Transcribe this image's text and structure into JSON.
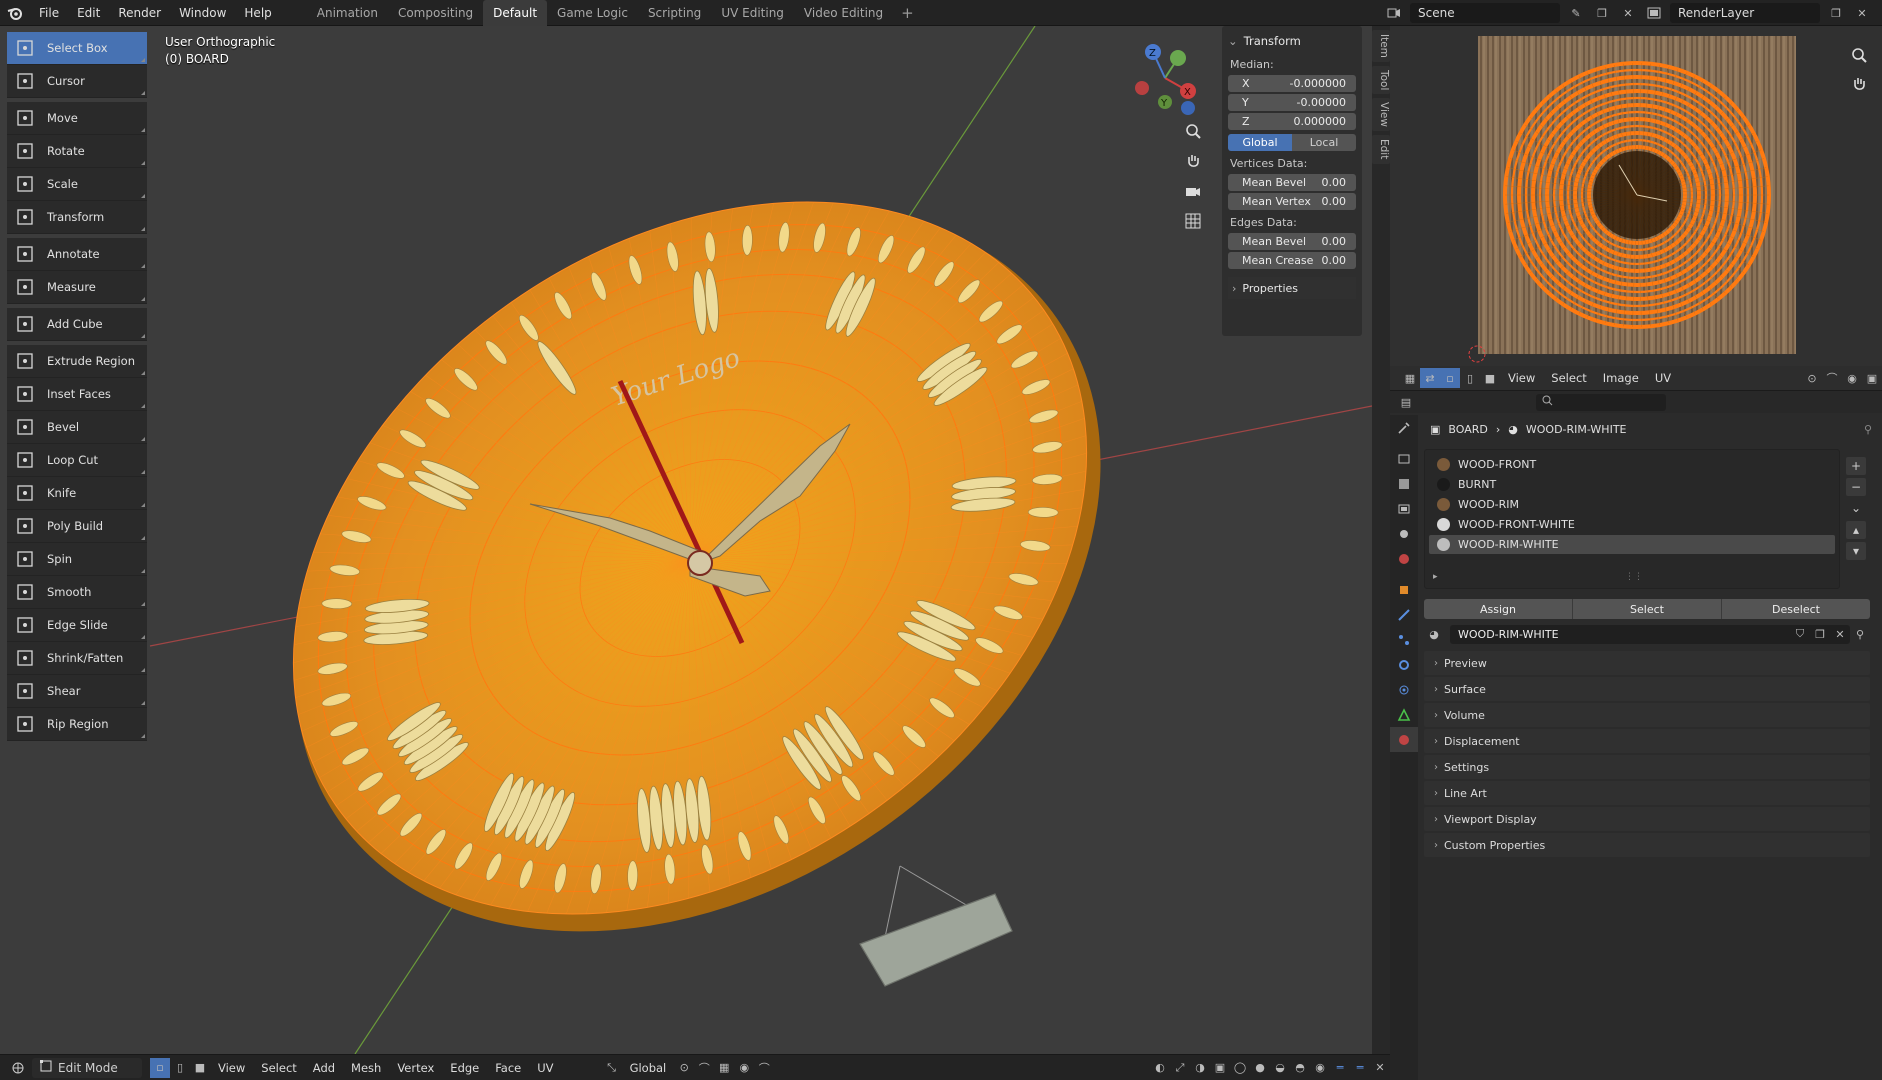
{
  "topbar": {
    "menus": [
      "File",
      "Edit",
      "Render",
      "Window",
      "Help"
    ],
    "workspaces": [
      "Animation",
      "Compositing",
      "Default",
      "Game Logic",
      "Scripting",
      "UV Editing",
      "Video Editing"
    ],
    "active_workspace": "Default",
    "add_symbol": "+",
    "scene": "Scene",
    "view_layer": "RenderLayer"
  },
  "viewport": {
    "view_name": "User Orthographic",
    "object_name": "(0) BOARD",
    "logo_text": "Your Logo"
  },
  "toolbar": {
    "groups": [
      [
        {
          "label": "Select Box",
          "active": true
        },
        {
          "label": "Cursor"
        }
      ],
      [
        {
          "label": "Move"
        },
        {
          "label": "Rotate"
        },
        {
          "label": "Scale"
        },
        {
          "label": "Transform"
        }
      ],
      [
        {
          "label": "Annotate"
        },
        {
          "label": "Measure"
        }
      ],
      [
        {
          "label": "Add Cube"
        }
      ],
      [
        {
          "label": "Extrude Region"
        },
        {
          "label": "Inset Faces"
        },
        {
          "label": "Bevel"
        },
        {
          "label": "Loop Cut"
        },
        {
          "label": "Knife"
        },
        {
          "label": "Poly Build"
        },
        {
          "label": "Spin"
        },
        {
          "label": "Smooth"
        },
        {
          "label": "Edge Slide"
        },
        {
          "label": "Shrink/Fatten"
        },
        {
          "label": "Shear"
        },
        {
          "label": "Rip Region"
        }
      ]
    ]
  },
  "npanel": {
    "title": "Transform",
    "median_label": "Median:",
    "x_label": "X",
    "x_value": "-0.000000",
    "y_label": "Y",
    "y_value": "-0.00000",
    "z_label": "Z",
    "z_value": "0.000000",
    "global_label": "Global",
    "local_label": "Local",
    "vertices_label": "Vertices Data:",
    "mean_bevel_label": "Mean Bevel",
    "mean_bevel_v": "0.00",
    "mean_vertex_label": "Mean Vertex",
    "mean_vertex_v": "0.00",
    "edges_label": "Edges Data:",
    "mean_bevel_e_label": "Mean Bevel",
    "mean_bevel_e": "0.00",
    "mean_crease_label": "Mean Crease",
    "mean_crease": "0.00",
    "properties_label": "Properties"
  },
  "sidetabs": [
    "Item",
    "Tool",
    "View",
    "Edit"
  ],
  "statusbar": {
    "mode": "Edit Mode",
    "menus": [
      "View",
      "Select",
      "Add",
      "Mesh",
      "Vertex",
      "Edge",
      "Face",
      "UV"
    ],
    "orientation": "Global"
  },
  "image_editor": {
    "menus": [
      "View",
      "Select",
      "Image",
      "UV"
    ]
  },
  "properties": {
    "object": "BOARD",
    "material": "WOOD-RIM-WHITE",
    "slots": [
      {
        "name": "WOOD-FRONT",
        "color": "#7a5a3a"
      },
      {
        "name": "BURNT",
        "color": "#1a1a1a"
      },
      {
        "name": "WOOD-RIM",
        "color": "#7a5a3a"
      },
      {
        "name": "WOOD-FRONT-WHITE",
        "color": "#d8d8d8"
      },
      {
        "name": "WOOD-RIM-WHITE",
        "color": "#bdbdbd",
        "active": true
      }
    ],
    "assign": "Assign",
    "select": "Select",
    "deselect": "Deselect",
    "sections": [
      "Preview",
      "Surface",
      "Volume",
      "Displacement",
      "Settings",
      "Line Art",
      "Viewport Display",
      "Custom Properties"
    ]
  },
  "colors": {
    "accent": "#4772b3",
    "mesh_orange": "#e8951f",
    "edge_orange": "#ff8a1f"
  }
}
